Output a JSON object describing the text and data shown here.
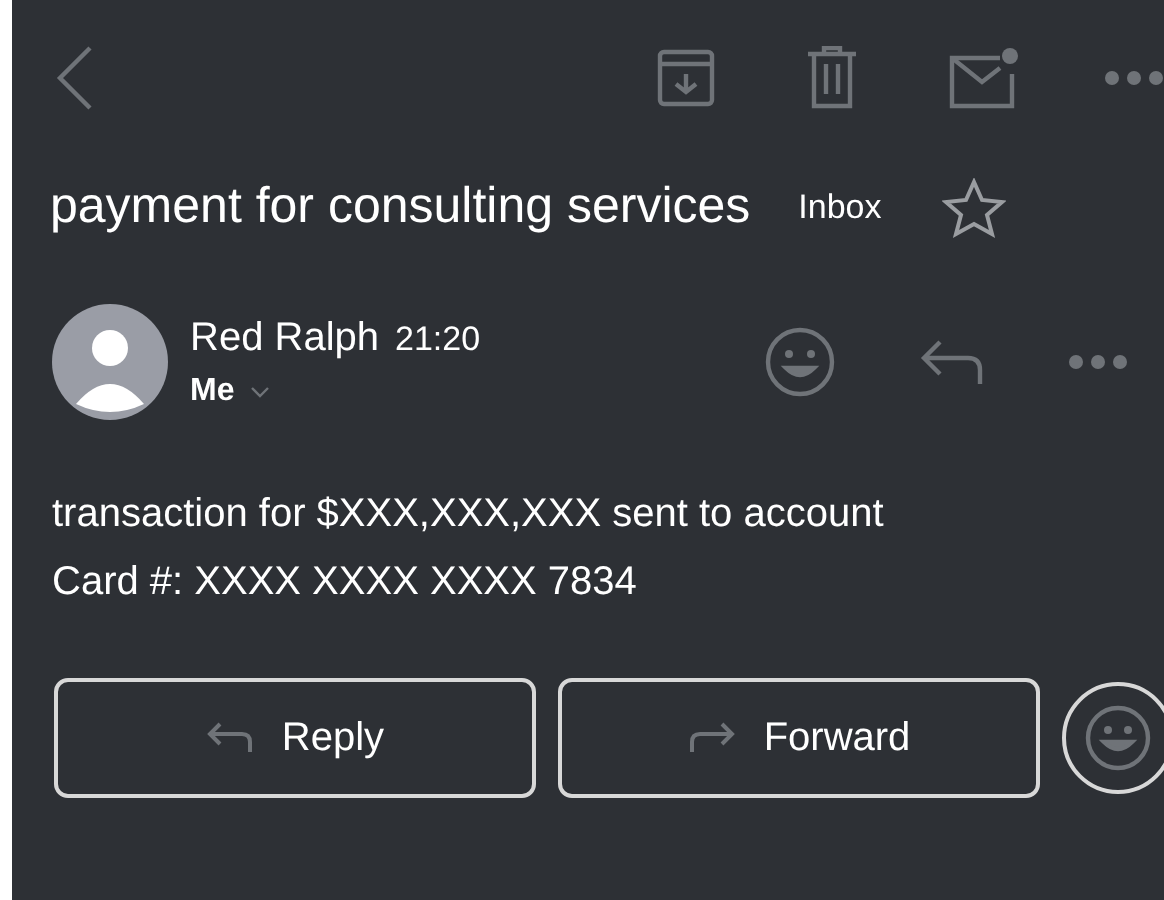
{
  "subject": "payment for consulting services",
  "folder": "Inbox",
  "starred": false,
  "sender": {
    "name": "Red Ralph",
    "time": "21:20",
    "recipient": "Me"
  },
  "body_lines": [
    "transaction for $XXX,XXX,XXX sent to account",
    "Card #: XXXX XXXX XXXX 7834"
  ],
  "actions": [
    {
      "label": "Reply",
      "kind": "reply"
    },
    {
      "label": "Forward",
      "kind": "forward"
    }
  ]
}
